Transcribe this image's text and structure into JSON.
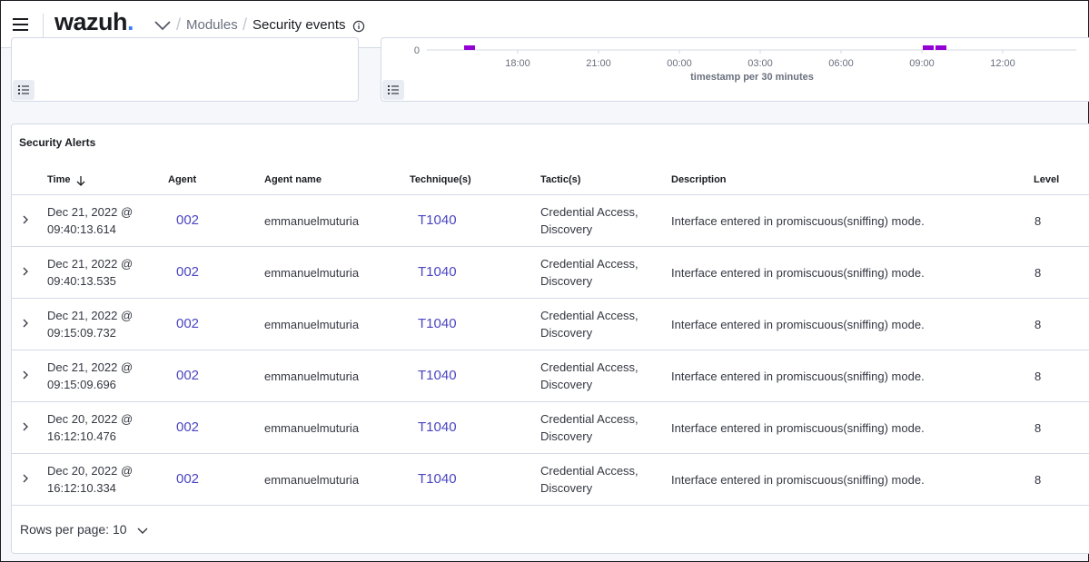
{
  "header": {
    "brand": "wazuh",
    "brand_dot": ".",
    "breadcrumb_sep": "/",
    "breadcrumb": [
      "Modules",
      "Security events"
    ]
  },
  "histogram": {
    "y_zero_label": "0",
    "x_ticks": [
      "18:00",
      "21:00",
      "00:00",
      "03:00",
      "06:00",
      "09:00",
      "12:00"
    ],
    "x_label": "timestamp per 30 minutes",
    "bar_color": "#9400d3"
  },
  "alerts": {
    "title": "Security Alerts",
    "columns": {
      "time": "Time",
      "agent": "Agent",
      "agent_name": "Agent name",
      "techniques": "Technique(s)",
      "tactics": "Tactic(s)",
      "description": "Description",
      "level": "Level"
    },
    "rows": [
      {
        "time_date": "Dec 21, 2022 @",
        "time_clock": "09:40:13.614",
        "agent": "002",
        "agent_name": "emmanuelmuturia",
        "technique": "T1040",
        "tactic_1": "Credential Access,",
        "tactic_2": "Discovery",
        "description": "Interface entered in promiscuous(sniffing) mode.",
        "level": "8"
      },
      {
        "time_date": "Dec 21, 2022 @",
        "time_clock": "09:40:13.535",
        "agent": "002",
        "agent_name": "emmanuelmuturia",
        "technique": "T1040",
        "tactic_1": "Credential Access,",
        "tactic_2": "Discovery",
        "description": "Interface entered in promiscuous(sniffing) mode.",
        "level": "8"
      },
      {
        "time_date": "Dec 21, 2022 @",
        "time_clock": "09:15:09.732",
        "agent": "002",
        "agent_name": "emmanuelmuturia",
        "technique": "T1040",
        "tactic_1": "Credential Access,",
        "tactic_2": "Discovery",
        "description": "Interface entered in promiscuous(sniffing) mode.",
        "level": "8"
      },
      {
        "time_date": "Dec 21, 2022 @",
        "time_clock": "09:15:09.696",
        "agent": "002",
        "agent_name": "emmanuelmuturia",
        "technique": "T1040",
        "tactic_1": "Credential Access,",
        "tactic_2": "Discovery",
        "description": "Interface entered in promiscuous(sniffing) mode.",
        "level": "8"
      },
      {
        "time_date": "Dec 20, 2022 @",
        "time_clock": "16:12:10.476",
        "agent": "002",
        "agent_name": "emmanuelmuturia",
        "technique": "T1040",
        "tactic_1": "Credential Access,",
        "tactic_2": "Discovery",
        "description": "Interface entered in promiscuous(sniffing) mode.",
        "level": "8"
      },
      {
        "time_date": "Dec 20, 2022 @",
        "time_clock": "16:12:10.334",
        "agent": "002",
        "agent_name": "emmanuelmuturia",
        "technique": "T1040",
        "tactic_1": "Credential Access,",
        "tactic_2": "Discovery",
        "description": "Interface entered in promiscuous(sniffing) mode.",
        "level": "8"
      }
    ],
    "rows_per_page": "Rows per page: 10"
  },
  "colors": {
    "link": "#4a45c1",
    "accent_purple": "#9400d3",
    "brand_dot": "#3d80ee"
  },
  "icons": [
    "menu-icon",
    "chevron-down-icon",
    "info-icon",
    "legend-list-icon",
    "sort-arrow-down-icon",
    "chevron-right-icon"
  ]
}
